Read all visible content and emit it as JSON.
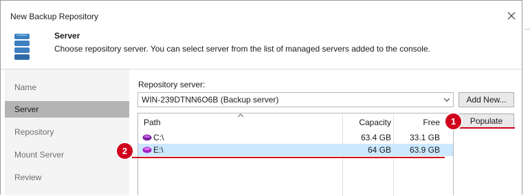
{
  "window": {
    "title": "New Backup Repository"
  },
  "header": {
    "title": "Server",
    "description": "Choose repository server. You can select server from the list of managed servers added to the console."
  },
  "steps": [
    {
      "label": "Name",
      "active": false
    },
    {
      "label": "Server",
      "active": true
    },
    {
      "label": "Repository",
      "active": false
    },
    {
      "label": "Mount Server",
      "active": false
    },
    {
      "label": "Review",
      "active": false
    }
  ],
  "server": {
    "label": "Repository server:",
    "selected": "WIN-239DTNN6O6B (Backup server)",
    "add_new_label": "Add New...",
    "populate_label": "Populate"
  },
  "table": {
    "columns": {
      "path": "Path",
      "capacity": "Capacity",
      "free": "Free"
    },
    "rows": [
      {
        "path": "C:\\",
        "capacity": "63.4 GB",
        "free": "33.1 GB",
        "selected": false
      },
      {
        "path": "E:\\",
        "capacity": "64 GB",
        "free": "63.9 GB",
        "selected": true
      }
    ]
  },
  "annotations": [
    {
      "number": "1"
    },
    {
      "number": "2"
    }
  ],
  "colors": {
    "accent_red": "#d0021b",
    "selection": "#cce8ff",
    "sidebar_active": "#b4b4b4"
  },
  "icons": {
    "close": "close-icon",
    "repository": "database-icon",
    "drive": "drive-icon",
    "dropdown": "chevron-down-icon"
  }
}
